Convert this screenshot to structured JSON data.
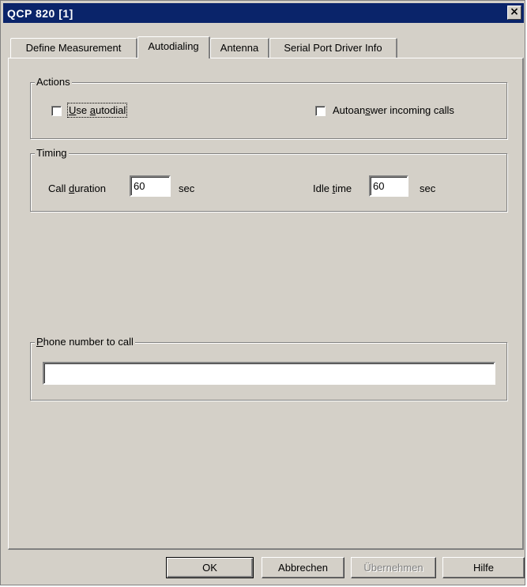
{
  "window": {
    "title": "QCP 820 [1]",
    "close_glyph": "×"
  },
  "tabs": [
    {
      "label": "Define Measurement",
      "active": false
    },
    {
      "label": "Autodialing",
      "active": true
    },
    {
      "label": "Antenna",
      "active": false
    },
    {
      "label": "Serial Port Driver Info",
      "active": false
    }
  ],
  "actions": {
    "label": "Actions",
    "use_autodial": {
      "label": "Use autodial",
      "checked": false
    },
    "autoanswer": {
      "label": "Autoanswer incoming calls",
      "checked": false
    }
  },
  "timing": {
    "label": "Timing",
    "call_duration": {
      "label": "Call duration",
      "value": "60",
      "unit": "sec"
    },
    "idle_time": {
      "label": "Idle time",
      "value": "60",
      "unit": "sec"
    }
  },
  "phone": {
    "label": "Phone number to call",
    "value": ""
  },
  "buttons": {
    "ok": "OK",
    "cancel": "Abbrechen",
    "apply": "Übernehmen",
    "help": "Hilfe"
  }
}
